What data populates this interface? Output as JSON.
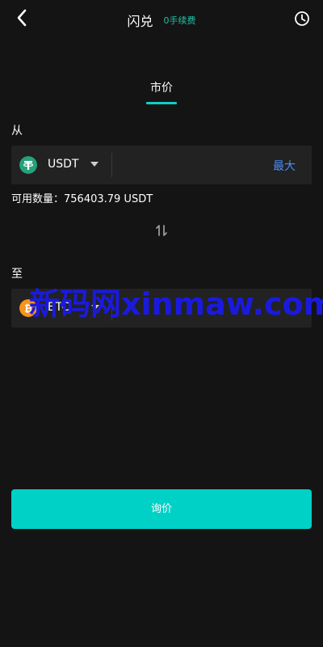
{
  "header": {
    "title": "闪兑",
    "fee_badge": "0手续费"
  },
  "tab": {
    "label": "市价"
  },
  "from": {
    "section_label": "从",
    "coin": "USDT",
    "coin_color": "#26a17b",
    "amount_value": "",
    "max_label": "最大",
    "available_text": "可用数量：756403.79 USDT"
  },
  "to": {
    "section_label": "至",
    "coin": "BTC",
    "coin_color": "#f7931a",
    "amount_value": ""
  },
  "watermark": "新码网xinmaw.com",
  "quote_button": "询价",
  "colors": {
    "accent": "#00d1c6",
    "link": "#4a8df8",
    "fee": "#1fc2a6",
    "background": "#141414",
    "panel": "#222222"
  },
  "icons": [
    "back-arrow-icon",
    "history-clock-icon",
    "usdt-coin-icon",
    "btc-coin-icon",
    "swap-arrows-icon",
    "dropdown-caret-icon"
  ]
}
